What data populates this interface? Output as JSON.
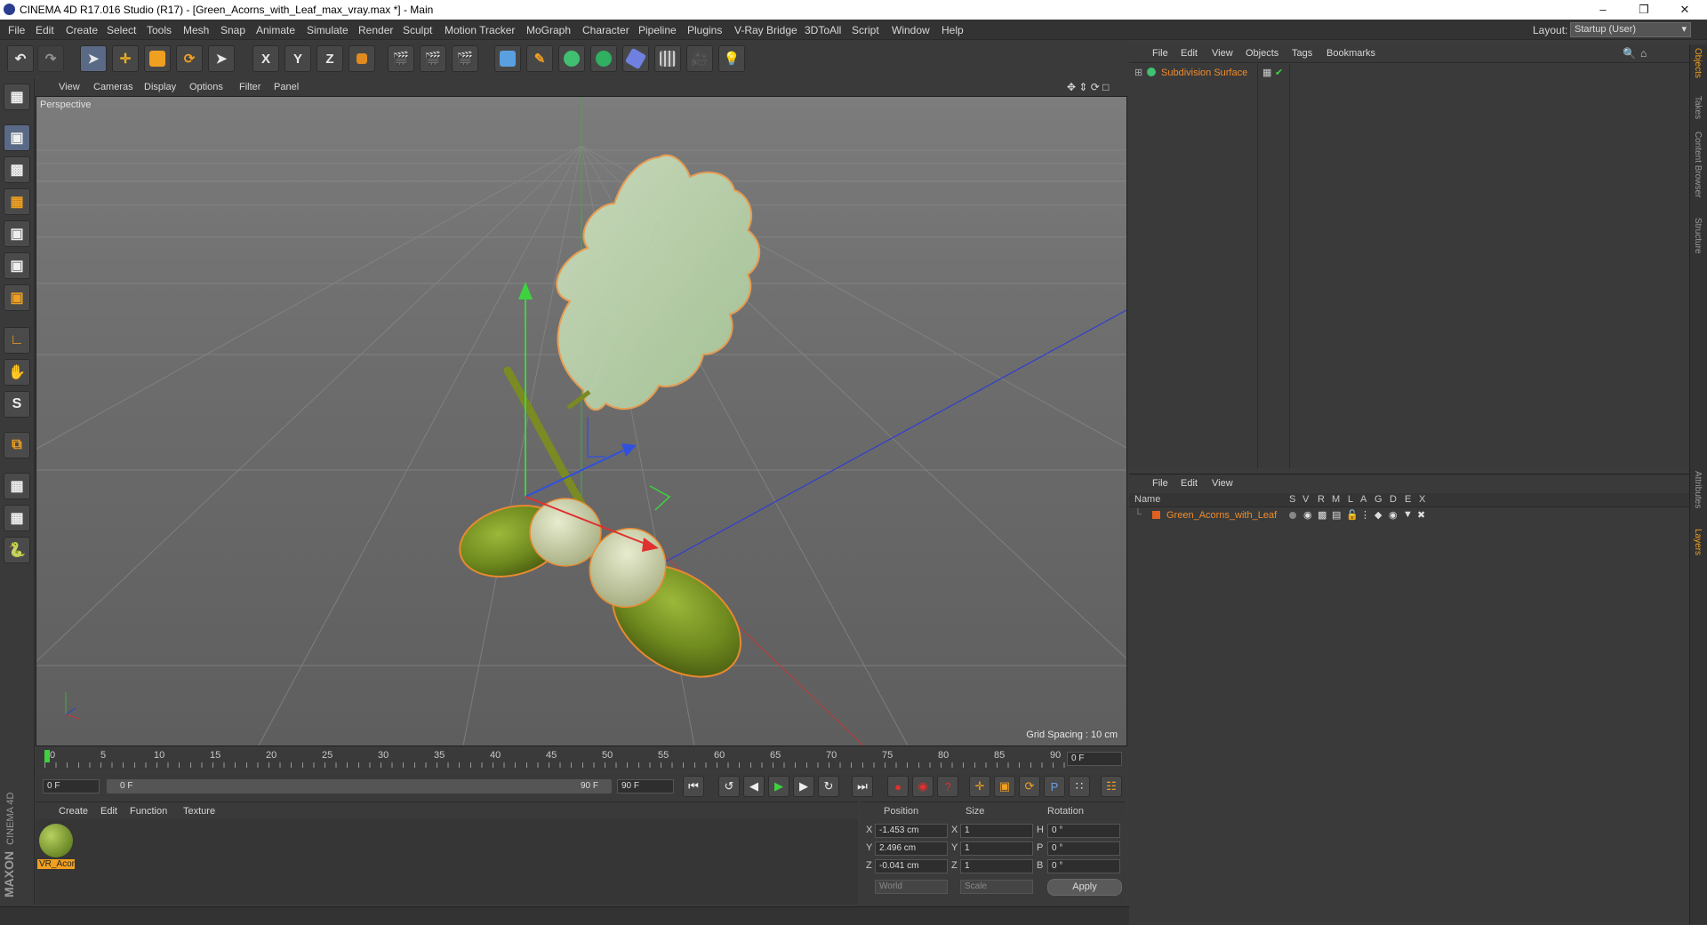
{
  "window": {
    "title": "CINEMA 4D R17.016 Studio (R17) - [Green_Acorns_with_Leaf_max_vray.max *] - Main"
  },
  "menubar": {
    "items": [
      "File",
      "Edit",
      "Create",
      "Select",
      "Tools",
      "Mesh",
      "Snap",
      "Animate",
      "Simulate",
      "Render",
      "Sculpt",
      "Motion Tracker",
      "MoGraph",
      "Character",
      "Pipeline",
      "Plugins",
      "V-Ray Bridge",
      "3DToAll",
      "Script",
      "Window",
      "Help"
    ],
    "layout_label": "Layout:",
    "layout_value": "Startup (User)"
  },
  "toolbar": {
    "axis_x": "X",
    "axis_y": "Y",
    "axis_z": "Z"
  },
  "viewport": {
    "menu": [
      "View",
      "Cameras",
      "Display",
      "Options",
      "Filter",
      "Panel"
    ],
    "label": "Perspective",
    "grid_spacing": "Grid Spacing : 10 cm"
  },
  "timeline": {
    "ticks": [
      "0",
      "5",
      "10",
      "15",
      "20",
      "25",
      "30",
      "35",
      "40",
      "45",
      "50",
      "55",
      "60",
      "65",
      "70",
      "75",
      "80",
      "85",
      "90"
    ],
    "current_frame": "0 F",
    "start_field": "0 F",
    "range_start": "0 F",
    "range_end": "90 F",
    "end_field": "90 F"
  },
  "material": {
    "menu": [
      "Create",
      "Edit",
      "Function",
      "Texture"
    ],
    "items": [
      {
        "name": "VR_Acor"
      }
    ],
    "brand": "MAXON",
    "brand_sub": "CINEMA 4D"
  },
  "coordinates": {
    "headers": {
      "position": "Position",
      "size": "Size",
      "rotation": "Rotation"
    },
    "rows": [
      {
        "axis": "X",
        "pos": "-1.453 cm",
        "size_axis": "X",
        "size": "1",
        "rot_axis": "H",
        "rot": "0 °"
      },
      {
        "axis": "Y",
        "pos": "2.496 cm",
        "size_axis": "Y",
        "size": "1",
        "rot_axis": "P",
        "rot": "0 °"
      },
      {
        "axis": "Z",
        "pos": "-0.041 cm",
        "size_axis": "Z",
        "size": "1",
        "rot_axis": "B",
        "rot": "0 °"
      }
    ],
    "world": "World",
    "scale": "Scale",
    "apply": "Apply"
  },
  "objects": {
    "menu": [
      "File",
      "Edit",
      "View",
      "Objects",
      "Tags",
      "Bookmarks"
    ],
    "items": [
      {
        "name": "Subdivision Surface"
      }
    ]
  },
  "layers": {
    "menu": [
      "File",
      "Edit",
      "View"
    ],
    "columns": [
      "Name",
      "S",
      "V",
      "R",
      "M",
      "L",
      "A",
      "G",
      "D",
      "E",
      "X"
    ],
    "items": [
      {
        "name": "Green_Acorns_with_Leaf"
      }
    ]
  },
  "side_tabs": [
    "Objects",
    "Takes",
    "Content Browser",
    "Structure",
    "Attributes",
    "Layers"
  ],
  "colors": {
    "accent": "#f08c2a",
    "selected": "#5a6a86"
  }
}
